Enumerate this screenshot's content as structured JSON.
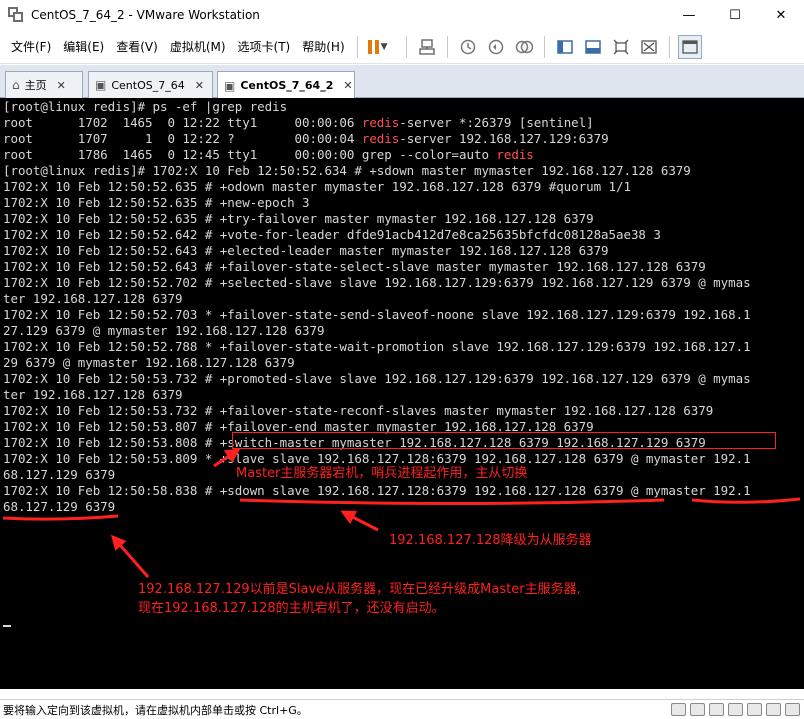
{
  "window": {
    "title": "CentOS_7_64_2 - VMware Workstation",
    "minimize": "—",
    "maximize": "☐",
    "close": "✕"
  },
  "menu": [
    "文件(F)",
    "编辑(E)",
    "查看(V)",
    "虚拟机(M)",
    "选项卡(T)",
    "帮助(H)"
  ],
  "tabs": [
    {
      "label": "主页",
      "active": false
    },
    {
      "label": "CentOS_7_64",
      "active": false
    },
    {
      "label": "CentOS_7_64_2",
      "active": true
    }
  ],
  "terminal": {
    "lines": [
      [
        {
          "t": "[root@linux redis]# ps -ef |grep redis"
        }
      ],
      [
        {
          "t": "root      1702  1465  0 12:22 tty1     00:00:06 "
        },
        {
          "t": "redis",
          "c": "red"
        },
        {
          "t": "-server *:26379 [sentinel]"
        }
      ],
      [
        {
          "t": "root      1707     1  0 12:22 ?        00:00:04 "
        },
        {
          "t": "redis",
          "c": "red"
        },
        {
          "t": "-server 192.168.127.129:6379"
        }
      ],
      [
        {
          "t": "root      1786  1465  0 12:45 tty1     00:00:00 grep --color=auto "
        },
        {
          "t": "redis",
          "c": "red"
        }
      ],
      [
        {
          "t": "[root@linux redis]# 1702:X 10 Feb 12:50:52.634 # +sdown master mymaster 192.168.127.128 6379"
        }
      ],
      [
        {
          "t": "1702:X 10 Feb 12:50:52.635 # +odown master mymaster 192.168.127.128 6379 #quorum 1/1"
        }
      ],
      [
        {
          "t": "1702:X 10 Feb 12:50:52.635 # +new-epoch 3"
        }
      ],
      [
        {
          "t": "1702:X 10 Feb 12:50:52.635 # +try-failover master mymaster 192.168.127.128 6379"
        }
      ],
      [
        {
          "t": "1702:X 10 Feb 12:50:52.642 # +vote-for-leader dfde91acb412d7e8ca25635bfcfdc08128a5ae38 3"
        }
      ],
      [
        {
          "t": "1702:X 10 Feb 12:50:52.643 # +elected-leader master mymaster 192.168.127.128 6379"
        }
      ],
      [
        {
          "t": "1702:X 10 Feb 12:50:52.643 # +failover-state-select-slave master mymaster 192.168.127.128 6379"
        }
      ],
      [
        {
          "t": "1702:X 10 Feb 12:50:52.702 # +selected-slave slave 192.168.127.129:6379 192.168.127.129 6379 @ mymas"
        }
      ],
      [
        {
          "t": "ter 192.168.127.128 6379"
        }
      ],
      [
        {
          "t": "1702:X 10 Feb 12:50:52.703 * +failover-state-send-slaveof-noone slave 192.168.127.129:6379 192.168.1"
        }
      ],
      [
        {
          "t": "27.129 6379 @ mymaster 192.168.127.128 6379"
        }
      ],
      [
        {
          "t": "1702:X 10 Feb 12:50:52.788 * +failover-state-wait-promotion slave 192.168.127.129:6379 192.168.127.1"
        }
      ],
      [
        {
          "t": "29 6379 @ mymaster 192.168.127.128 6379"
        }
      ],
      [
        {
          "t": "1702:X 10 Feb 12:50:53.732 # +promoted-slave slave 192.168.127.129:6379 192.168.127.129 6379 @ mymas"
        }
      ],
      [
        {
          "t": "ter 192.168.127.128 6379"
        }
      ],
      [
        {
          "t": "1702:X 10 Feb 12:50:53.732 # +failover-state-reconf-slaves master mymaster 192.168.127.128 6379"
        }
      ],
      [
        {
          "t": "1702:X 10 Feb 12:50:53.807 # +failover-end master mymaster 192.168.127.128 6379"
        }
      ],
      [
        {
          "t": "1702:X 10 Feb 12:50:53.808 # +switch-master mymaster 192.168.127.128 6379 192.168.127.129 6379"
        }
      ],
      [
        {
          "t": "1702:X 10 Feb 12:50:53.809 * +slave slave 192.168.127.128:6379 192.168.127.128 6379 @ mymaster 192.1"
        }
      ],
      [
        {
          "t": "68.127.129 6379"
        }
      ],
      [
        {
          "t": "1702:X 10 Feb 12:50:58.838 # +sdown slave 192.168.127.128:6379 192.168.127.128 6379 @ mymaster 192.1"
        }
      ],
      [
        {
          "t": "68.127.129 6379"
        }
      ]
    ]
  },
  "annotations": {
    "switch_note": "Master主服务器宕机，哨兵进程起作用，主从切换",
    "demote_note": "192.168.127.128降级为从服务器",
    "promote_note_1": "192.168.127.129以前是Slave从服务器，现在已经升级成Master主服务器,",
    "promote_note_2": "现在192.168.127.128的主机宕机了，还没有启动。",
    "color": "#ff2020"
  },
  "status": {
    "text": "要将输入定向到该虚拟机，请在虚拟机内部单击或按 Ctrl+G。"
  }
}
